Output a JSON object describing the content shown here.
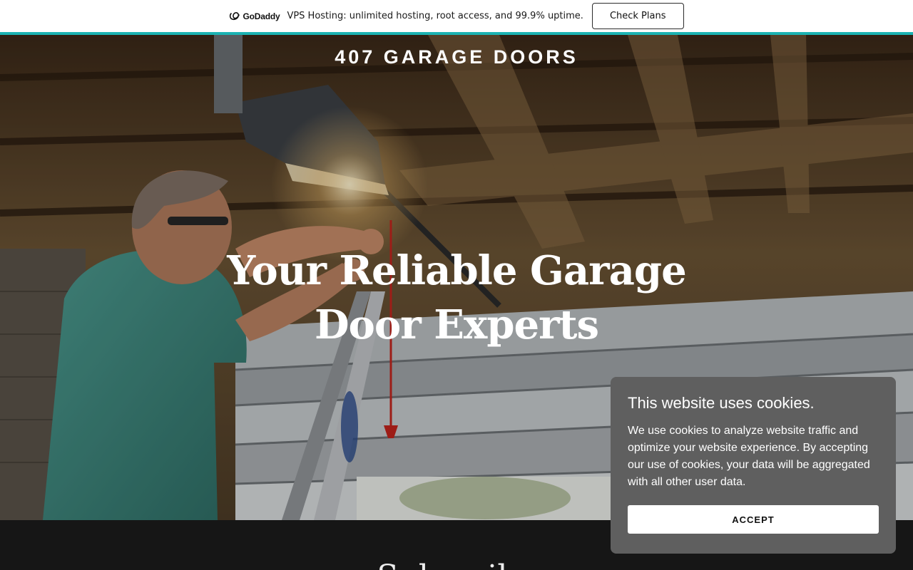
{
  "promo": {
    "brand": "GoDaddy",
    "text": "VPS Hosting: unlimited hosting, root access, and 99.9% uptime.",
    "button": "Check Plans",
    "accent_color": "#1bb3b3"
  },
  "header": {
    "site_title": "407 GARAGE DOORS"
  },
  "hero": {
    "heading": "Your Reliable Garage Door Experts",
    "image": "technician-on-ladder-fixing-garage-door-opener"
  },
  "section": {
    "heading": "Subscribe"
  },
  "cookie": {
    "title": "This website uses cookies.",
    "body": "We use cookies to analyze website traffic and optimize your website experience. By accepting our use of cookies, your data will be aggregated with all other user data.",
    "accept": "ACCEPT",
    "panel_color": "#5f5f5f"
  }
}
